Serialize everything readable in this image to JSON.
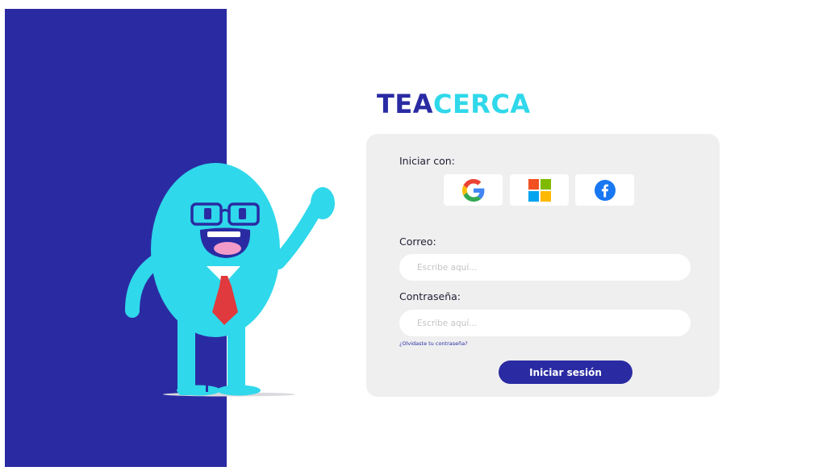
{
  "brand": {
    "logo_part1": "TEA",
    "logo_part2": "CERCA"
  },
  "login": {
    "social_heading": "Iniciar con:",
    "social_providers": [
      {
        "name": "Google",
        "icon": "google-icon"
      },
      {
        "name": "Microsoft",
        "icon": "microsoft-icon"
      },
      {
        "name": "Facebook",
        "icon": "facebook-icon"
      }
    ],
    "email_label": "Correo:",
    "email_placeholder": "Escribe aquí...",
    "password_label": "Contraseña:",
    "password_placeholder": "Escribe aquí...",
    "forgot_link": "¿Olvidaste tu contraseña?",
    "submit_label": "Iniciar sesión"
  },
  "colors": {
    "primary": "#2a2ba3",
    "accent": "#2fd8ea",
    "card_bg": "#efeff0",
    "tie": "#e0393e"
  }
}
